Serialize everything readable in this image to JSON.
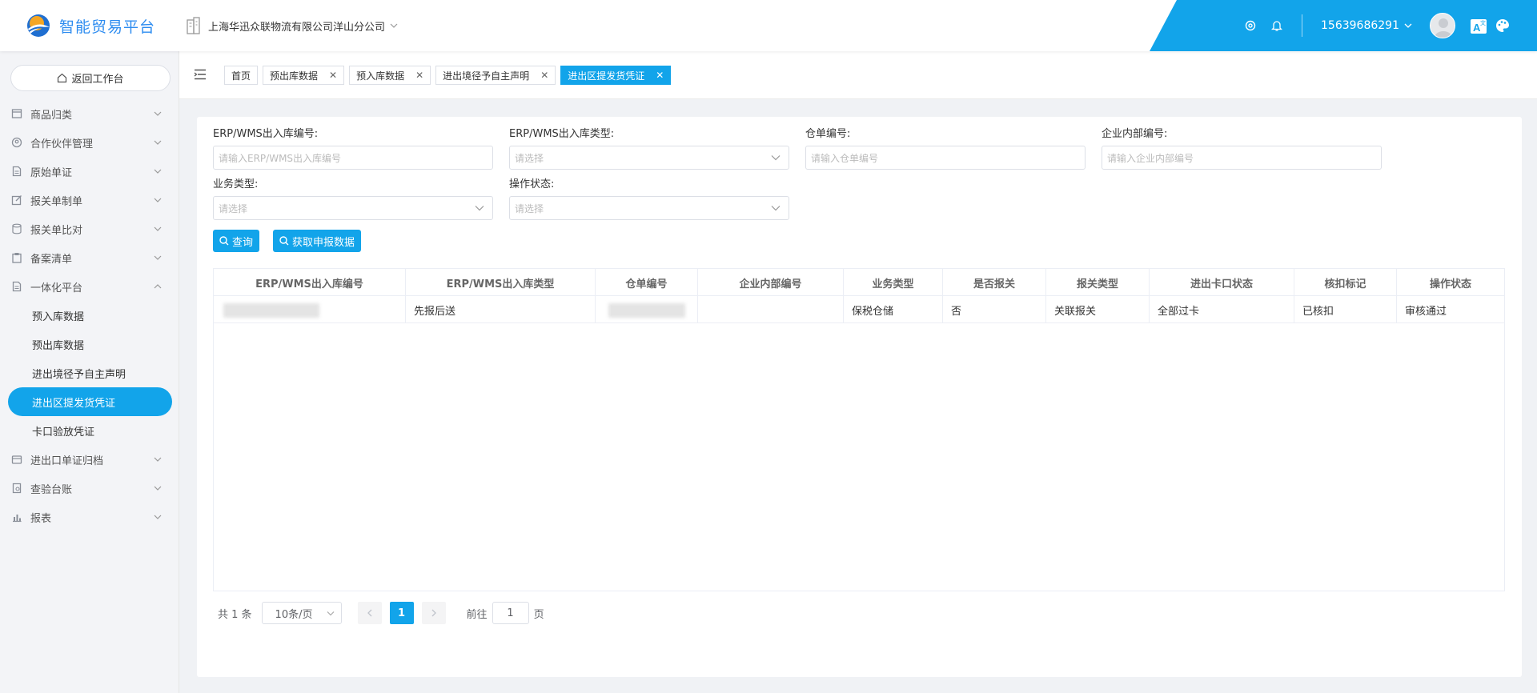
{
  "header": {
    "logo_text": "智能贸易平台",
    "company": "上海华迅众联物流有限公司洋山分公司",
    "user_phone": "15639686291"
  },
  "sidebar": {
    "back_label": "返回工作台",
    "items": [
      {
        "label": "商品归类",
        "icon": "box-icon"
      },
      {
        "label": "合作伙伴管理",
        "icon": "partner-icon"
      },
      {
        "label": "原始单证",
        "icon": "document-icon"
      },
      {
        "label": "报关单制单",
        "icon": "edit-icon"
      },
      {
        "label": "报关单比对",
        "icon": "database-icon"
      },
      {
        "label": "备案清单",
        "icon": "clipboard-icon"
      },
      {
        "label": "一体化平台",
        "icon": "document-icon"
      }
    ],
    "subitems": [
      "预入库数据",
      "预出库数据",
      "进出境径予自主声明",
      "进出区提发货凭证",
      "卡口验放凭证"
    ],
    "items_after": [
      {
        "label": "进出口单证归档",
        "icon": "archive-icon"
      },
      {
        "label": "查验台账",
        "icon": "ledger-icon"
      },
      {
        "label": "报表",
        "icon": "chart-icon"
      }
    ]
  },
  "tabs": [
    "首页",
    "预出库数据",
    "预入库数据",
    "进出境径予自主声明",
    "进出区提发货凭证"
  ],
  "filters": {
    "erp_no": {
      "label": "ERP/WMS出入库编号:",
      "placeholder": "请输入ERP/WMS出入库编号"
    },
    "erp_type": {
      "label": "ERP/WMS出入库类型:",
      "placeholder": "请选择"
    },
    "warehouse_no": {
      "label": "仓单编号:",
      "placeholder": "请输入仓单编号"
    },
    "internal_no": {
      "label": "企业内部编号:",
      "placeholder": "请输入企业内部编号"
    },
    "biz_type": {
      "label": "业务类型:",
      "placeholder": "请选择"
    },
    "op_status": {
      "label": "操作状态:",
      "placeholder": "请选择"
    }
  },
  "buttons": {
    "query": "查询",
    "fetch": "获取申报数据"
  },
  "table": {
    "columns": [
      "ERP/WMS出入库编号",
      "ERP/WMS出入库类型",
      "仓单编号",
      "企业内部编号",
      "业务类型",
      "是否报关",
      "报关类型",
      "进出卡口状态",
      "核扣标记",
      "操作状态"
    ],
    "rows": [
      [
        "",
        "先报后送",
        "",
        "",
        "保税仓储",
        "否",
        "关联报关",
        "全部过卡",
        "已核扣",
        "审核通过"
      ]
    ]
  },
  "pagination": {
    "total": "共 1 条",
    "page_size": "10条/页",
    "current": "1",
    "goto_label": "前往",
    "goto_value": "1",
    "page_suffix": "页"
  },
  "colors": {
    "accent": "#12a4ea",
    "logo": "#2d8cf0"
  }
}
